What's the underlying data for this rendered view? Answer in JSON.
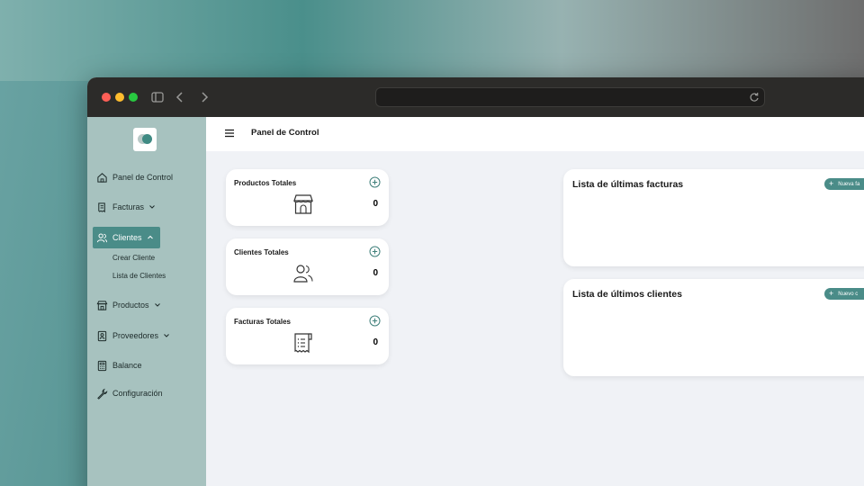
{
  "sidebar": {
    "items": [
      {
        "label": "Panel de Control",
        "icon": "home-icon"
      },
      {
        "label": "Facturas",
        "icon": "receipt-icon"
      },
      {
        "label": "Clientes",
        "icon": "users-icon"
      },
      {
        "label": "Productos",
        "icon": "store-icon"
      },
      {
        "label": "Proveedores",
        "icon": "contact-icon"
      },
      {
        "label": "Balance",
        "icon": "calculator-icon"
      },
      {
        "label": "Configuración",
        "icon": "wrench-icon"
      }
    ],
    "clientes_sub": [
      "Crear Cliente",
      "Lista de Clientes"
    ]
  },
  "header": {
    "title": "Panel de Control"
  },
  "stats": [
    {
      "label": "Productos Totales",
      "value": "0",
      "icon": "store-icon"
    },
    {
      "label": "Clientes Totales",
      "value": "0",
      "icon": "users-icon"
    },
    {
      "label": "Facturas Totales",
      "value": "0",
      "icon": "receipt-icon"
    }
  ],
  "lists": [
    {
      "title": "Lista de últimas facturas",
      "button": "Nueva fa"
    },
    {
      "title": "Lista de últimos clientes",
      "button": "Nuevo c"
    }
  ],
  "colors": {
    "accent": "#4a8c88",
    "sidebar_bg": "#a7c2bf",
    "titlebar": "#2c2b29"
  }
}
